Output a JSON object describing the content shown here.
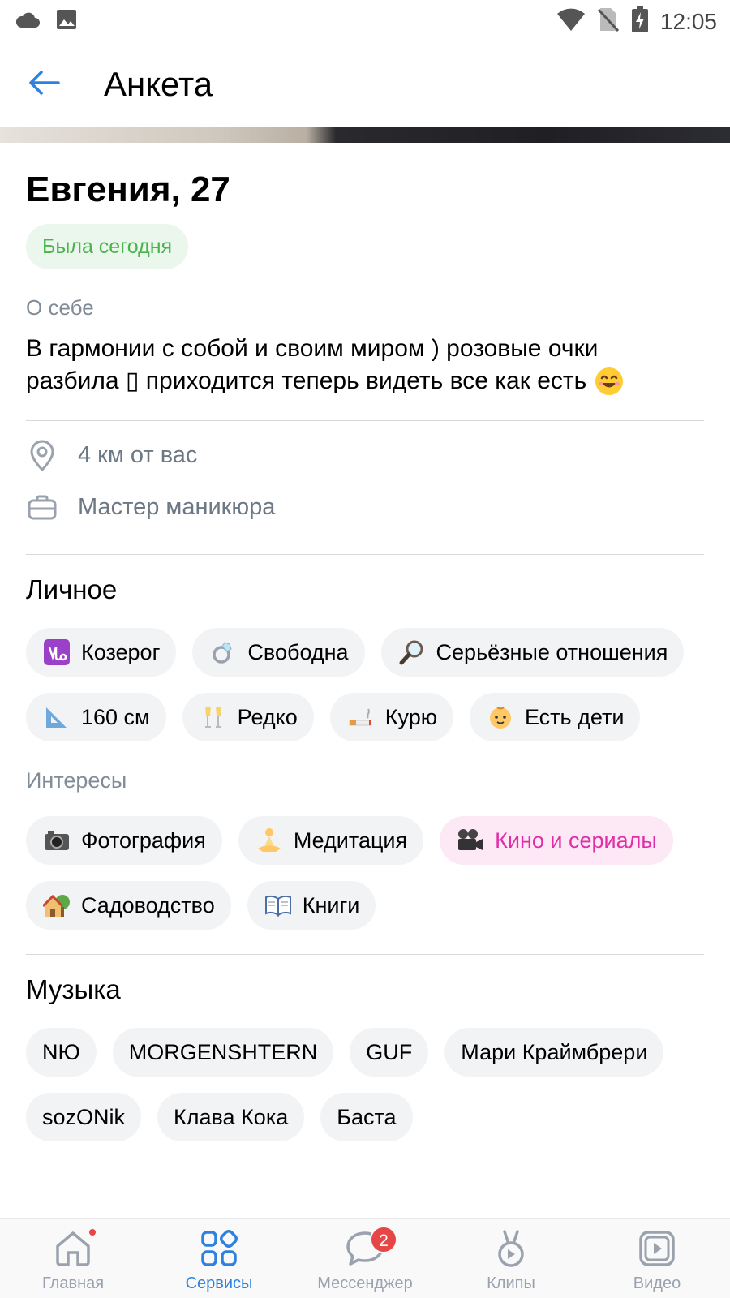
{
  "status_bar": {
    "time": "12:05",
    "icons": [
      "cloud-icon",
      "image-icon",
      "wifi-icon",
      "no-sim-icon",
      "battery-charging-icon"
    ]
  },
  "app_bar": {
    "title": "Анкета",
    "back_icon": "arrow-left-icon"
  },
  "profile": {
    "name_age": "Евгения, 27",
    "online_status": "Была сегодня",
    "about_label": "О себе",
    "about_text_line1": "В гармонии с собой и своим миром ) розовые очки",
    "about_text_line2": "разбила ▯ приходится теперь видеть все как есть",
    "about_emoji": "smiling-face-emoji",
    "distance": "4 км от вас",
    "occupation": "Мастер маникюра"
  },
  "personal": {
    "title": "Личное",
    "chips": [
      {
        "emoji": "capricorn-emoji",
        "label": "Козерог"
      },
      {
        "emoji": "ring-emoji",
        "label": "Свободна"
      },
      {
        "emoji": "magnifier-emoji",
        "label": "Серьёзные отношения"
      },
      {
        "emoji": "triangle-ruler-emoji",
        "label": "160 см"
      },
      {
        "emoji": "champagne-emoji",
        "label": "Редко"
      },
      {
        "emoji": "cigarette-emoji",
        "label": "Курю"
      },
      {
        "emoji": "baby-emoji",
        "label": "Есть дети"
      }
    ]
  },
  "interests": {
    "label": "Интересы",
    "chips": [
      {
        "emoji": "camera-emoji",
        "label": "Фотография"
      },
      {
        "emoji": "meditation-emoji",
        "label": "Медитация"
      },
      {
        "emoji": "movie-camera-emoji",
        "label": "Кино и сериалы",
        "highlighted": true
      },
      {
        "emoji": "garden-house-emoji",
        "label": "Садоводство"
      },
      {
        "emoji": "open-book-emoji",
        "label": "Книги"
      }
    ]
  },
  "music": {
    "title": "Музыка",
    "chips": [
      "NЮ",
      "MORGENSHTERN",
      "GUF",
      "Мари Краймбрери",
      "sozONik",
      "Клава Кока",
      "Баста"
    ]
  },
  "tab_bar": {
    "tabs": [
      {
        "label": "Главная",
        "icon": "home-icon"
      },
      {
        "label": "Сервисы",
        "icon": "services-grid-icon",
        "active": true
      },
      {
        "label": "Мессенджер",
        "icon": "chat-bubble-icon",
        "badge": "2"
      },
      {
        "label": "Клипы",
        "icon": "clips-icon"
      },
      {
        "label": "Видео",
        "icon": "video-play-icon"
      }
    ]
  },
  "colors": {
    "accent": "#2d81e0",
    "online_green": "#4bb34b",
    "highlight_pink": "#e02ea7",
    "chip_bg": "#f2f3f5",
    "badge_red": "#e64646"
  }
}
